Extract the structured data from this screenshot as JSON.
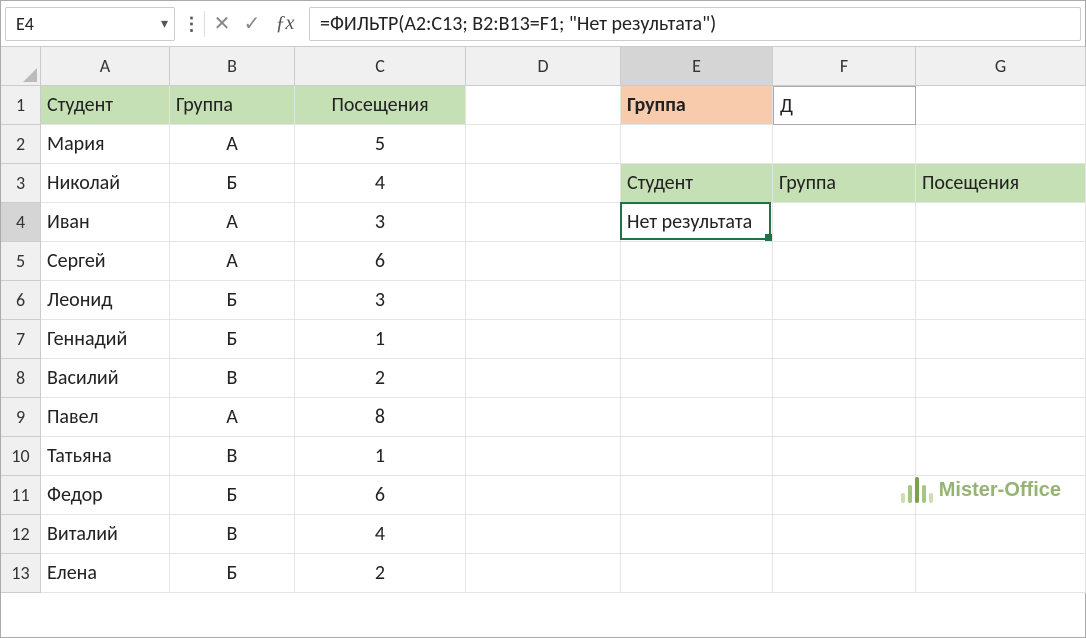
{
  "namebox": {
    "value": "E4"
  },
  "formula": "=ФИЛЬТР(A2:C13; B2:B13=F1; \"Нет результата\")",
  "columns": [
    "A",
    "B",
    "C",
    "D",
    "E",
    "F",
    "G"
  ],
  "rows": [
    "1",
    "2",
    "3",
    "4",
    "5",
    "6",
    "7",
    "8",
    "9",
    "10",
    "11",
    "12",
    "13"
  ],
  "activeCol": "E",
  "activeRow": "4",
  "headers_left": {
    "A": "Студент",
    "B": "Группа",
    "C": "Посещения"
  },
  "filter_label": "Группа",
  "filter_value": "Д",
  "headers_right": {
    "E": "Студент",
    "F": "Группа",
    "G": "Посещения"
  },
  "result_text": "Нет результата",
  "table": [
    {
      "name": "Мария",
      "group": "А",
      "visits": "5"
    },
    {
      "name": "Николай",
      "group": "Б",
      "visits": "4"
    },
    {
      "name": "Иван",
      "group": "А",
      "visits": "3"
    },
    {
      "name": "Сергей",
      "group": "А",
      "visits": "6"
    },
    {
      "name": "Леонид",
      "group": "Б",
      "visits": "3"
    },
    {
      "name": "Геннадий",
      "group": "Б",
      "visits": "1"
    },
    {
      "name": "Василий",
      "group": "В",
      "visits": "2"
    },
    {
      "name": "Павел",
      "group": "А",
      "visits": "8"
    },
    {
      "name": "Татьяна",
      "group": "В",
      "visits": "1"
    },
    {
      "name": "Федор",
      "group": "Б",
      "visits": "6"
    },
    {
      "name": "Виталий",
      "group": "В",
      "visits": "4"
    },
    {
      "name": "Елена",
      "group": "Б",
      "visits": "2"
    }
  ],
  "watermark": "Mister-Office"
}
